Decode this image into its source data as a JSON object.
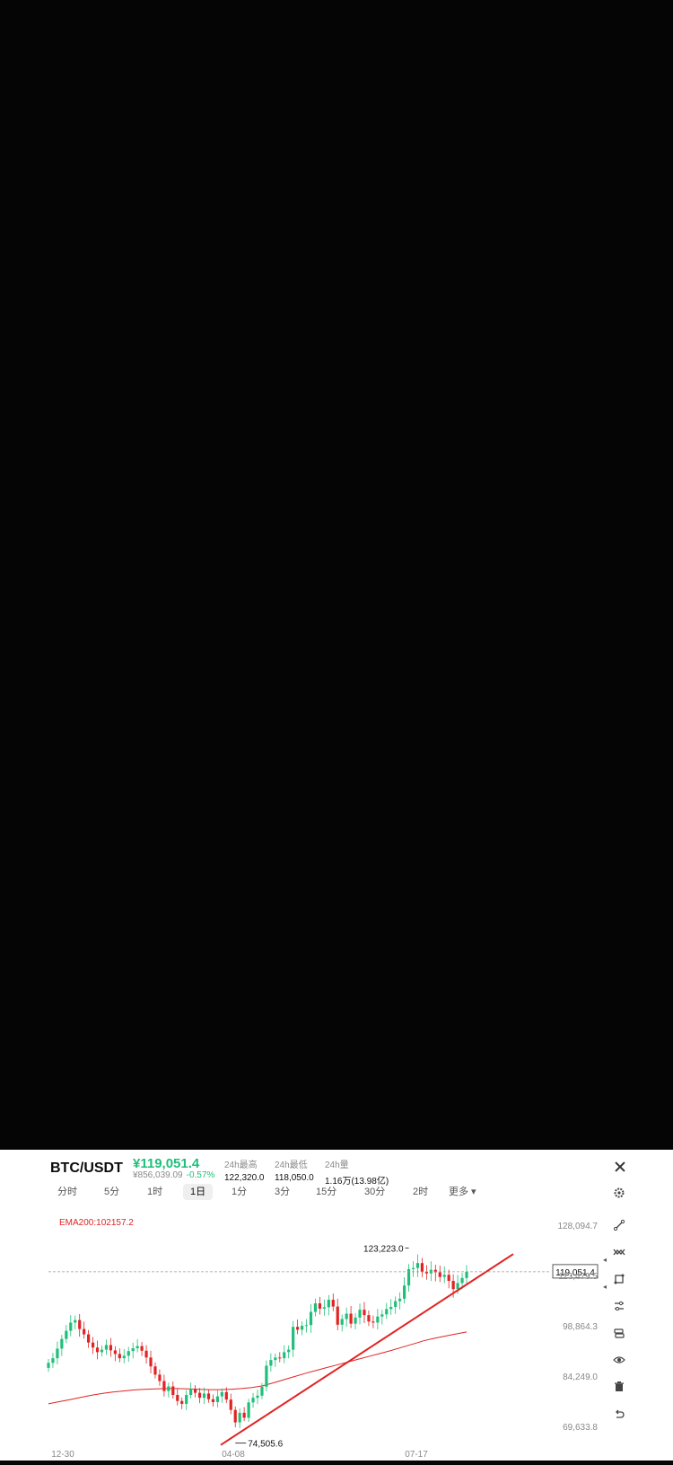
{
  "header": {
    "pair": "BTC/USDT",
    "price": "¥119,051.4",
    "sub_price": "¥856,039.09",
    "change": "-0.57%",
    "stats": [
      {
        "label": "24h最高",
        "value": "122,320.0"
      },
      {
        "label": "24h最低",
        "value": "118,050.0"
      },
      {
        "label": "24h量",
        "value": "1.16万(13.98亿)"
      }
    ]
  },
  "tabs": [
    {
      "label": "分时",
      "active": false
    },
    {
      "label": "5分",
      "active": false
    },
    {
      "label": "1时",
      "active": false
    },
    {
      "label": "1日",
      "active": true
    },
    {
      "label": "1分",
      "active": false
    },
    {
      "label": "3分",
      "active": false
    },
    {
      "label": "15分",
      "active": false
    },
    {
      "label": "30分",
      "active": false
    },
    {
      "label": "2时",
      "active": false
    },
    {
      "label": "更多 ▾",
      "active": false
    }
  ],
  "icons": {
    "close": "close-icon",
    "settings": "gear-icon",
    "tools": [
      "line-tool-icon",
      "crossline-icon",
      "shape-tool-icon",
      "adjust-icon",
      "layers-icon",
      "eye-icon",
      "trash-icon",
      "undo-icon"
    ]
  },
  "colors": {
    "up": "#1fbf7a",
    "down": "#e02424",
    "ema": "#e02424",
    "trendline": "#e02424"
  },
  "chart_data": {
    "type": "candlestick",
    "indicator": "EMA200:102157.2",
    "y_ticks": [
      "128,094.7",
      "113,479.5",
      "98,864.3",
      "84,249.0",
      "69,633.8"
    ],
    "ylim": [
      69633.8,
      128094.7
    ],
    "x_ticks": [
      "12-30",
      "04-08",
      "07-17"
    ],
    "current_price": "119,051.4",
    "high_label": "123,223.0",
    "low_label": "74,505.6",
    "close_series": [
      93500,
      94800,
      97500,
      100200,
      102500,
      104800,
      105500,
      103000,
      101500,
      99200,
      97800,
      96500,
      97200,
      98500,
      97000,
      96000,
      94800,
      95500,
      96800,
      97600,
      98200,
      96900,
      95000,
      92500,
      90200,
      88400,
      85600,
      86900,
      84500,
      82800,
      82000,
      84500,
      86200,
      85100,
      83700,
      84900,
      83300,
      82500,
      84100,
      85300,
      83200,
      80300,
      76800,
      79500,
      78100,
      82400,
      83700,
      84300,
      86800,
      92700,
      94300,
      95000,
      94800,
      96500,
      97200,
      103600,
      102800,
      103900,
      104100,
      107800,
      110200,
      108700,
      109100,
      111200,
      109300,
      104200,
      105800,
      107300,
      104500,
      106200,
      108400,
      106900,
      105100,
      104800,
      106500,
      107100,
      108600,
      109200,
      110800,
      111500,
      115200,
      119800,
      120100,
      121500,
      119000,
      118600,
      119600,
      118900,
      117600,
      118200,
      116500,
      114200,
      115900,
      117300,
      119051.4
    ],
    "ema_series": [
      82000,
      82600,
      83200,
      83800,
      84400,
      84900,
      85300,
      85600,
      85900,
      86100,
      86200,
      86300,
      86300,
      86200,
      86100,
      86000,
      86000,
      86100,
      86300,
      86600,
      87100,
      87900,
      88800,
      89700,
      90600,
      91400,
      92200,
      93000,
      93800,
      94600,
      95400,
      96200,
      97000,
      97900,
      98800,
      99700,
      100400,
      101000,
      101600,
      102157.2
    ]
  }
}
